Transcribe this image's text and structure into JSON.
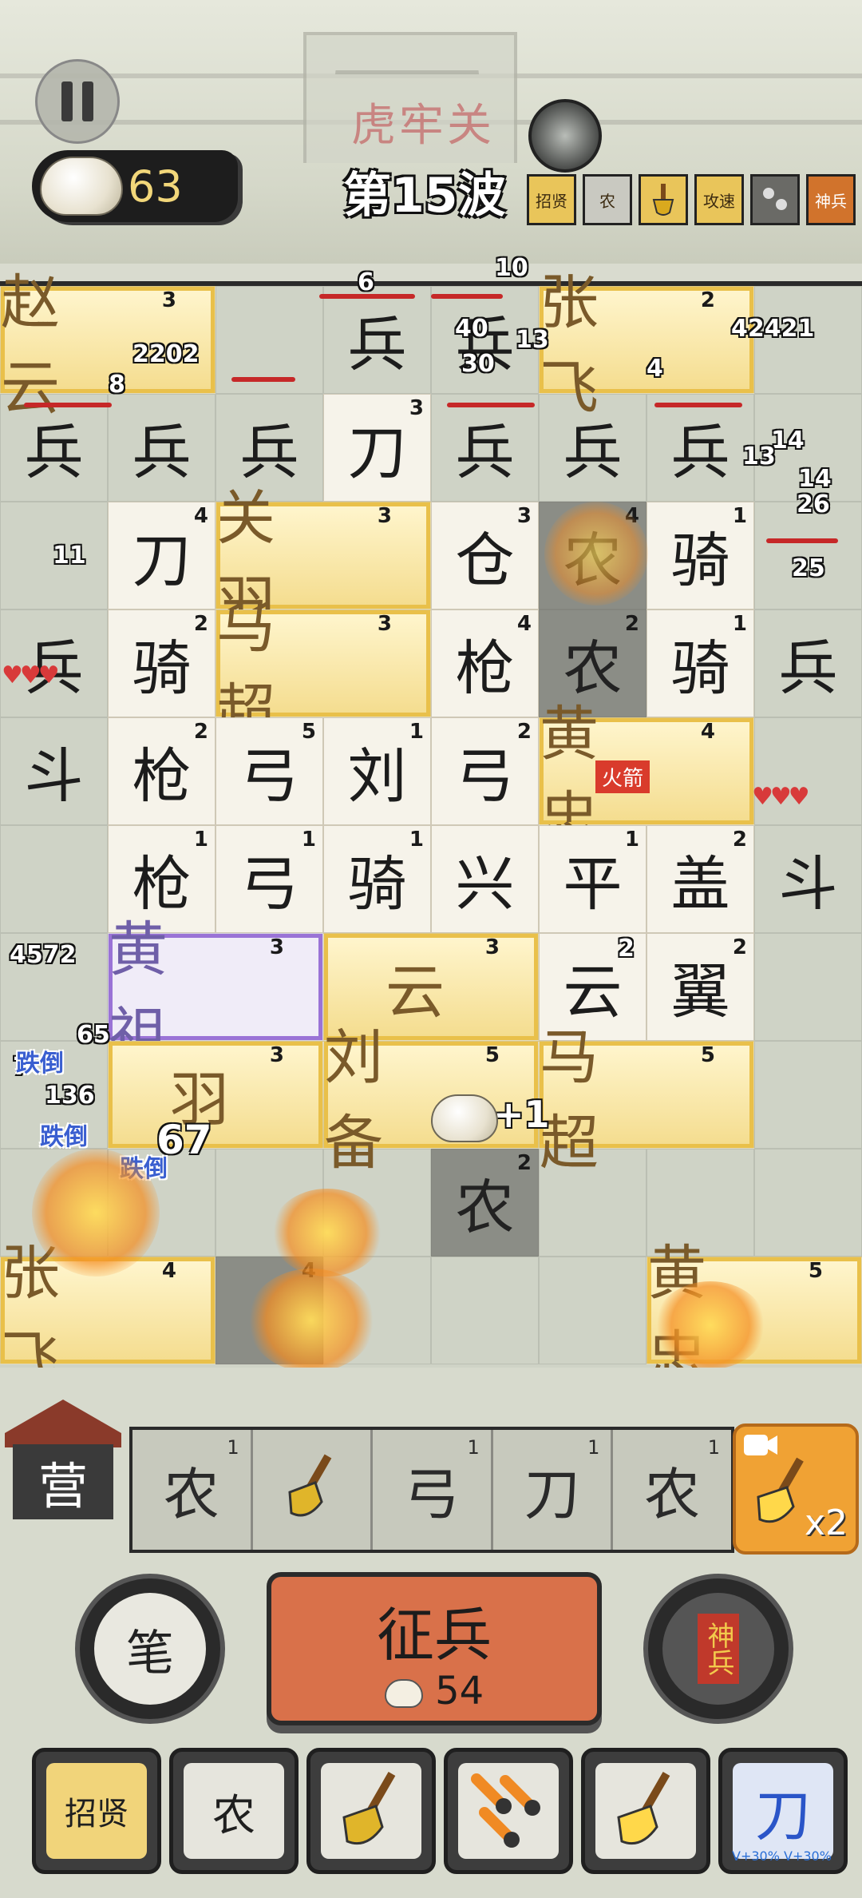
{
  "header": {
    "fort_name": "虎牢关",
    "coins": "63",
    "wave": "第15波",
    "buffs": [
      {
        "label": "招贤",
        "icon": "recruit-scroll-icon",
        "style": "gold"
      },
      {
        "label": "农",
        "icon": "farmer-icon",
        "style": "gray"
      },
      {
        "label": "",
        "icon": "shovel-icon",
        "style": "gold"
      },
      {
        "label": "攻速",
        "icon": "attack-speed-icon",
        "style": "gold"
      },
      {
        "label": "",
        "icon": "meteor-icon",
        "style": "dark"
      },
      {
        "label": "神兵",
        "icon": "divine-weapon-icon",
        "style": "red"
      }
    ]
  },
  "board": {
    "cells": [
      {
        "t": "赵 云",
        "lv": "3",
        "s": "gold span2"
      },
      {
        "t": "",
        "lv": "",
        "s": "skip"
      },
      {
        "t": "",
        "lv": "",
        "s": ""
      },
      {
        "t": "兵",
        "lv": "",
        "s": ""
      },
      {
        "t": "兵",
        "lv": "",
        "s": ""
      },
      {
        "t": "张 飞",
        "lv": "2",
        "s": "gold span2"
      },
      {
        "t": "",
        "lv": "",
        "s": "skip"
      },
      {
        "t": "",
        "lv": "",
        "s": ""
      },
      {
        "t": "兵",
        "lv": "",
        "s": ""
      },
      {
        "t": "兵",
        "lv": "",
        "s": ""
      },
      {
        "t": "兵",
        "lv": "",
        "s": ""
      },
      {
        "t": "刀",
        "lv": "3",
        "s": "white"
      },
      {
        "t": "兵",
        "lv": "",
        "s": ""
      },
      {
        "t": "兵",
        "lv": "",
        "s": ""
      },
      {
        "t": "兵",
        "lv": "",
        "s": ""
      },
      {
        "t": "",
        "lv": "",
        "s": ""
      },
      {
        "t": "",
        "lv": "",
        "s": ""
      },
      {
        "t": "刀",
        "lv": "4",
        "s": "white"
      },
      {
        "t": "关 羽",
        "lv": "3",
        "s": "gold span2"
      },
      {
        "t": "",
        "lv": "",
        "s": "skip"
      },
      {
        "t": "仓",
        "lv": "3",
        "s": "white"
      },
      {
        "t": "农",
        "lv": "4",
        "s": "dark"
      },
      {
        "t": "骑",
        "lv": "1",
        "s": "white"
      },
      {
        "t": "",
        "lv": "",
        "s": ""
      },
      {
        "t": "兵",
        "lv": "",
        "s": ""
      },
      {
        "t": "骑",
        "lv": "2",
        "s": "white"
      },
      {
        "t": "马 超",
        "lv": "3",
        "s": "gold span2"
      },
      {
        "t": "",
        "lv": "",
        "s": "skip"
      },
      {
        "t": "枪",
        "lv": "4",
        "s": "white"
      },
      {
        "t": "农",
        "lv": "2",
        "s": "dark"
      },
      {
        "t": "骑",
        "lv": "1",
        "s": "white"
      },
      {
        "t": "兵",
        "lv": "",
        "s": ""
      },
      {
        "t": "斗",
        "lv": "",
        "s": ""
      },
      {
        "t": "枪",
        "lv": "2",
        "s": "white"
      },
      {
        "t": "弓",
        "lv": "5",
        "s": "white"
      },
      {
        "t": "刘",
        "lv": "1",
        "s": "white"
      },
      {
        "t": "弓",
        "lv": "2",
        "s": "white"
      },
      {
        "t": "黄 忠",
        "lv": "4",
        "s": "gold span2"
      },
      {
        "t": "",
        "lv": "",
        "s": "skip"
      },
      {
        "t": "",
        "lv": "",
        "s": ""
      },
      {
        "t": "",
        "lv": "",
        "s": ""
      },
      {
        "t": "枪",
        "lv": "1",
        "s": "white"
      },
      {
        "t": "弓",
        "lv": "1",
        "s": "white"
      },
      {
        "t": "骑",
        "lv": "1",
        "s": "white"
      },
      {
        "t": "兴",
        "lv": "",
        "s": "white"
      },
      {
        "t": "平",
        "lv": "1",
        "s": "white"
      },
      {
        "t": "盖",
        "lv": "2",
        "s": "white"
      },
      {
        "t": "斗",
        "lv": "",
        "s": ""
      },
      {
        "t": "",
        "lv": "",
        "s": ""
      },
      {
        "t": "黄 祖",
        "lv": "3",
        "s": "purple span2"
      },
      {
        "t": "",
        "lv": "",
        "s": "skip"
      },
      {
        "t": "云",
        "lv": "3",
        "s": "gold span2"
      },
      {
        "t": "",
        "lv": "",
        "s": "skip"
      },
      {
        "t": "云",
        "lv": "",
        "s": "white"
      },
      {
        "t": "翼",
        "lv": "2",
        "s": "white"
      },
      {
        "t": "",
        "lv": "",
        "s": ""
      },
      {
        "t": "",
        "lv": "",
        "s": ""
      },
      {
        "t": "羽",
        "lv": "3",
        "s": "gold span2"
      },
      {
        "t": "",
        "lv": "",
        "s": "skip"
      },
      {
        "t": "刘 备",
        "lv": "5",
        "s": "gold span2"
      },
      {
        "t": "",
        "lv": "",
        "s": "skip"
      },
      {
        "t": "马 超",
        "lv": "5",
        "s": "gold span2"
      },
      {
        "t": "",
        "lv": "",
        "s": "skip"
      },
      {
        "t": "",
        "lv": "",
        "s": ""
      },
      {
        "t": "",
        "lv": "",
        "s": ""
      },
      {
        "t": "",
        "lv": "",
        "s": ""
      },
      {
        "t": "",
        "lv": "",
        "s": ""
      },
      {
        "t": "",
        "lv": "",
        "s": ""
      },
      {
        "t": "农",
        "lv": "2",
        "s": "dark"
      },
      {
        "t": "",
        "lv": "",
        "s": ""
      },
      {
        "t": "",
        "lv": "",
        "s": ""
      },
      {
        "t": "",
        "lv": "",
        "s": ""
      },
      {
        "t": "张 飞",
        "lv": "4",
        "s": "gold span2"
      },
      {
        "t": "",
        "lv": "",
        "s": "skip"
      },
      {
        "t": "",
        "lv": "4",
        "s": "dark"
      },
      {
        "t": "",
        "lv": "",
        "s": ""
      },
      {
        "t": "",
        "lv": "",
        "s": ""
      },
      {
        "t": "",
        "lv": "",
        "s": ""
      },
      {
        "t": "黄 忠",
        "lv": "5",
        "s": "gold span2"
      },
      {
        "t": "",
        "lv": "",
        "s": "skip"
      }
    ],
    "damage_numbers": [
      "6",
      "10",
      "40",
      "13",
      "30",
      "4",
      "42421",
      "2202",
      "8",
      "14",
      "13",
      "14",
      "26",
      "25",
      "11",
      "4572",
      "65",
      "7",
      "136",
      "67",
      "2",
      "+1"
    ],
    "status_texts": [
      "跌倒",
      "跌倒",
      "跌倒",
      "火箭"
    ]
  },
  "bottom": {
    "camp_label": "营",
    "slots": [
      {
        "label": "农",
        "lv": "1"
      },
      {
        "label": "",
        "lv": "",
        "icon": "shovel-icon"
      },
      {
        "label": "弓",
        "lv": "1"
      },
      {
        "label": "刀",
        "lv": "1"
      },
      {
        "label": "农",
        "lv": "1"
      }
    ],
    "shovel_bonus": "x2",
    "brush_label": "笔",
    "recruit_label": "征兵",
    "recruit_cost": "54",
    "divine_label": "神兵",
    "tools": [
      {
        "label": "招贤",
        "icon": "recruit-scroll-icon"
      },
      {
        "label": "农",
        "icon": "farmer-icon"
      },
      {
        "label": "",
        "icon": "shovel-icon"
      },
      {
        "label": "",
        "icon": "meteor-icon"
      },
      {
        "label": "",
        "icon": "golden-shovel-icon"
      },
      {
        "label": "刀",
        "icon": "blade-icon",
        "sub": "V+30% V+30%"
      }
    ]
  }
}
